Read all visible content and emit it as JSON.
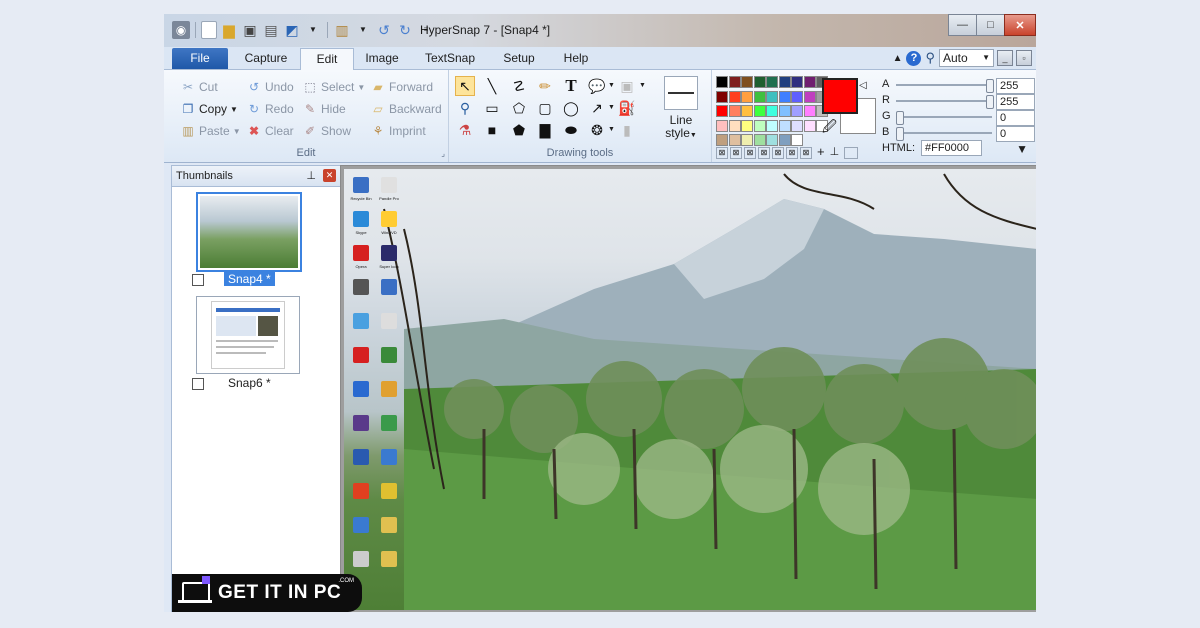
{
  "window": {
    "title": "HyperSnap 7 - [Snap4 *]",
    "controls": {
      "minimize": "—",
      "maximize": "□",
      "close": "✕"
    }
  },
  "tabs": [
    {
      "label": "File"
    },
    {
      "label": "Capture"
    },
    {
      "label": "Edit"
    },
    {
      "label": "Image"
    },
    {
      "label": "TextSnap"
    },
    {
      "label": "Setup"
    },
    {
      "label": "Help"
    }
  ],
  "tabbar_right": {
    "zoom_value": "Auto",
    "caret": "▲"
  },
  "edit_group": {
    "label": "Edit",
    "cut": "Cut",
    "copy": "Copy",
    "paste": "Paste",
    "undo": "Undo",
    "redo": "Redo",
    "clear": "Clear",
    "select": "Select",
    "hide": "Hide",
    "show": "Show",
    "forward": "Forward",
    "backward": "Backward",
    "imprint": "Imprint"
  },
  "drawing_group": {
    "label": "Drawing tools",
    "line_style_1": "Line",
    "line_style_2": "style"
  },
  "color_panel": {
    "primary_color": "#FF0000",
    "html_label": "HTML:",
    "html_value": "#FF0000",
    "channels": [
      {
        "label": "A",
        "value": "255",
        "level": 1.0
      },
      {
        "label": "R",
        "value": "255",
        "level": 1.0
      },
      {
        "label": "G",
        "value": "0",
        "level": 0.0
      },
      {
        "label": "B",
        "value": "0",
        "level": 0.0
      }
    ],
    "palette": [
      "#000000",
      "#7f1f1f",
      "#7f4f1f",
      "#1f5f2f",
      "#1f6f4f",
      "#1f3f7f",
      "#2f2f7f",
      "#6f1f6f",
      "#5f5f5f",
      "#7f0000",
      "#ff3f1f",
      "#ff9f3f",
      "#3fbf3f",
      "#3fbfbf",
      "#3f7fff",
      "#5f5fff",
      "#bf3fbf",
      "#9f9f9f",
      "#ff0000",
      "#ff7f5f",
      "#ffbf3f",
      "#3fff3f",
      "#3fffdf",
      "#7fbfff",
      "#9f9fff",
      "#ff7fff",
      "#bfbfbf",
      "#ffbfbf",
      "#ffdfbf",
      "#ffff7f",
      "#bfffbf",
      "#bfffff",
      "#bfdfff",
      "#dfdfff",
      "#ffdfff",
      "#ffffff",
      "#bf9f7f",
      "#dfbf9f",
      "#efefaf",
      "#9fdf9f",
      "#9fdfdf",
      "#7f9fbf",
      "#ffffff"
    ]
  },
  "thumbnails": {
    "header": "Thumbnails",
    "items": [
      {
        "label": "Snap4 *",
        "selected": true
      },
      {
        "label": "Snap6 *",
        "selected": false
      }
    ]
  },
  "desktop_icons": [
    "Recycle Bin",
    "Pandle Pro",
    "Skype",
    "WinDVD",
    "Opera",
    "Super Icon",
    "",
    "",
    "",
    "",
    "",
    "",
    "",
    "",
    "",
    "",
    "",
    "",
    "",
    "",
    "",
    "",
    "",
    ""
  ],
  "brand": {
    "text": "GET IT IN PC",
    "small": ".COM"
  }
}
